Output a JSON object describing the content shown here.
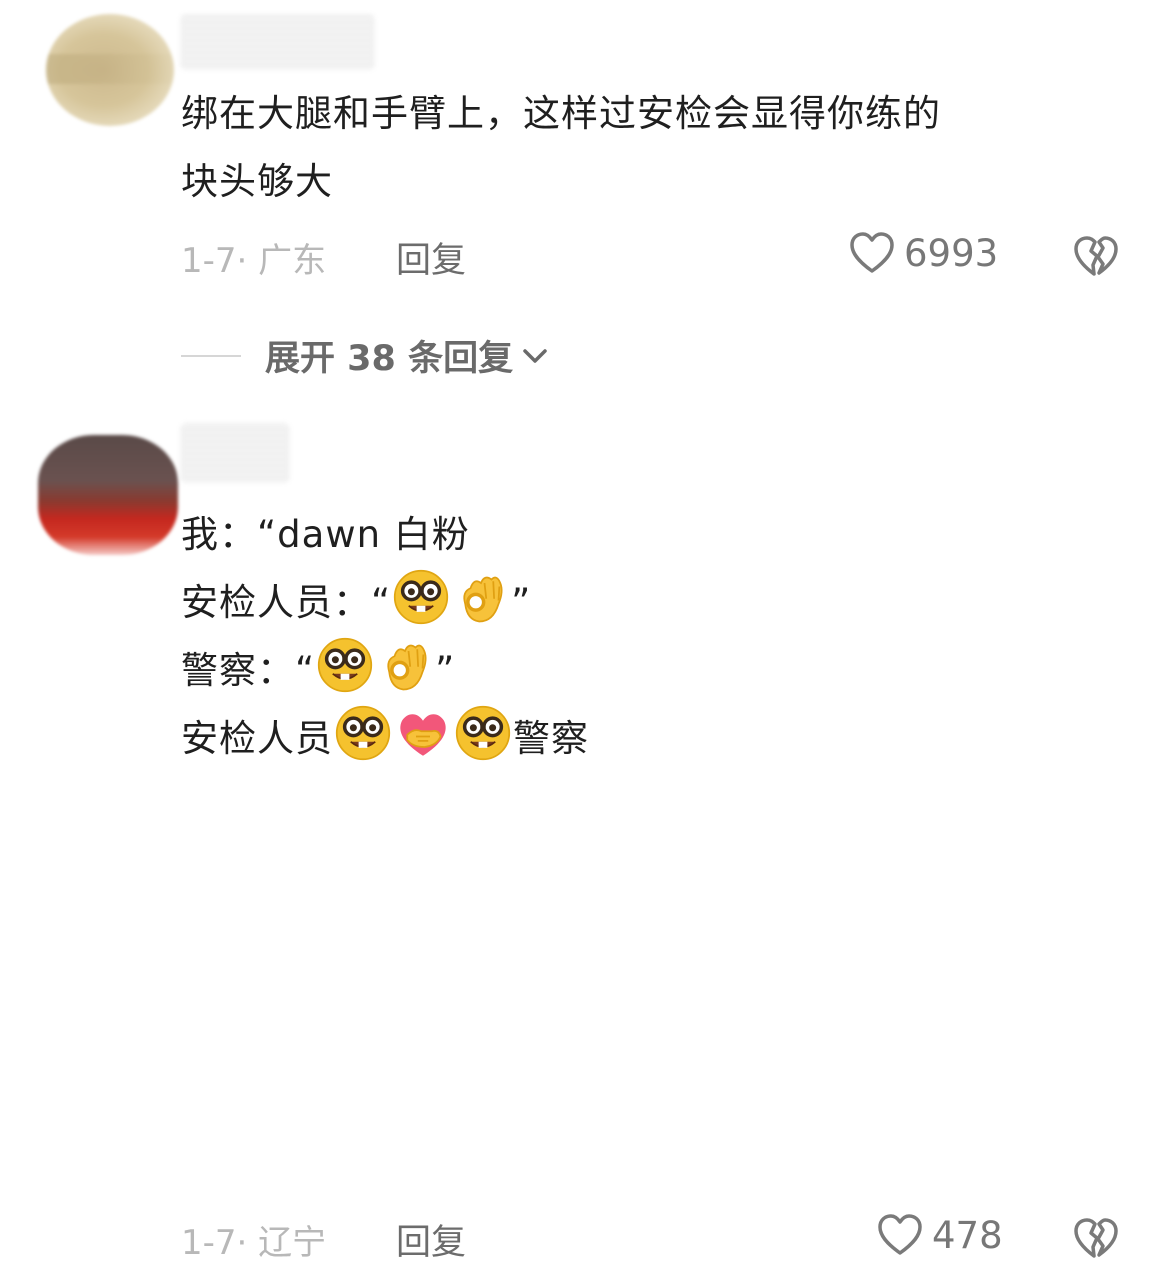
{
  "comments": [
    {
      "text_lines": [
        "绑在大腿和手臂上，这样过安检会显得你练的",
        "块头够大"
      ],
      "date_location": "1-7· 广东",
      "reply_label": "回复",
      "likes": "6993"
    },
    {
      "text_lines": [
        {
          "before": "我：“dawn 白粉",
          "after": ""
        },
        {
          "before": "安检人员：“",
          "after": "”"
        },
        {
          "before": "警察：“",
          "after": "”"
        },
        {
          "before": "安检人员",
          "after": "警察"
        }
      ],
      "emoji": [
        "nerd-face",
        "ok-hand",
        "handshake-heart"
      ],
      "date_location": "1-7· 辽宁",
      "reply_label": "回复",
      "likes": "478"
    }
  ],
  "expand_replies": {
    "label": "展开 38 条回复"
  }
}
